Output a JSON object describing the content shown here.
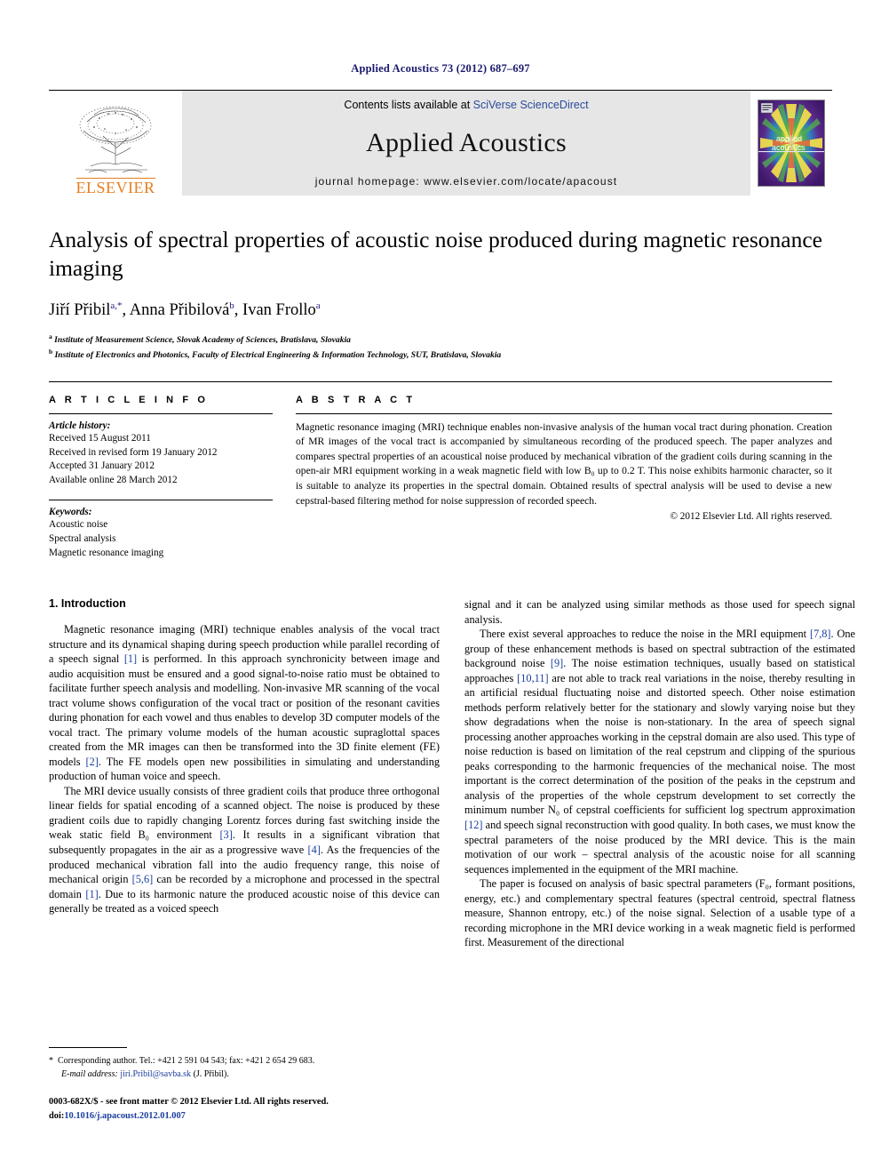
{
  "running_head": "Applied Acoustics 73 (2012) 687–697",
  "banner": {
    "publisher": "ELSEVIER",
    "contents_prefix": "Contents lists available at ",
    "contents_link": "SciVerse ScienceDirect",
    "journal_name": "Applied Acoustics",
    "homepage": "journal homepage: www.elsevier.com/locate/apacoust",
    "cover_line1": "applied",
    "cover_line2": "acoustics",
    "colors": {
      "link_blue": "#2a4b9b",
      "elsevier_orange": "#e87d1e",
      "banner_grey": "#e6e6e6",
      "citation_blue": "#1a3f9e",
      "runhead_navy": "#1a1a6e"
    }
  },
  "article": {
    "title": "Analysis of spectral properties of acoustic noise produced during magnetic resonance imaging",
    "authors": [
      {
        "name": "Jiří Přibil",
        "sup": "a,*"
      },
      {
        "name": "Anna Přibilová",
        "sup": "b"
      },
      {
        "name": "Ivan Frollo",
        "sup": "a"
      }
    ],
    "affiliations": [
      {
        "mark": "a",
        "text": "Institute of Measurement Science, Slovak Academy of Sciences, Bratislava, Slovakia"
      },
      {
        "mark": "b",
        "text": "Institute of Electronics and Photonics, Faculty of Electrical Engineering & Information Technology, SUT, Bratislava, Slovakia"
      }
    ]
  },
  "info": {
    "heading": "A R T I C L E   I N F O",
    "history_label": "Article history:",
    "history": [
      "Received 15 August 2011",
      "Received in revised form 19 January 2012",
      "Accepted 31 January 2012",
      "Available online 28 March 2012"
    ],
    "keywords_label": "Keywords:",
    "keywords": [
      "Acoustic noise",
      "Spectral analysis",
      "Magnetic resonance imaging"
    ]
  },
  "abstract": {
    "heading": "A B S T R A C T",
    "text": "Magnetic resonance imaging (MRI) technique enables non-invasive analysis of the human vocal tract during phonation. Creation of MR images of the vocal tract is accompanied by simultaneous recording of the produced speech. The paper analyzes and compares spectral properties of an acoustical noise produced by mechanical vibration of the gradient coils during scanning in the open-air MRI equipment working in a weak magnetic field with low B₀ up to 0.2 T. This noise exhibits harmonic character, so it is suitable to analyze its properties in the spectral domain. Obtained results of spectral analysis will be used to devise a new cepstral-based filtering method for noise suppression of recorded speech.",
    "copyright": "© 2012 Elsevier Ltd. All rights reserved."
  },
  "body": {
    "section_heading": "1. Introduction",
    "left_paragraphs": [
      "Magnetic resonance imaging (MRI) technique enables analysis of the vocal tract structure and its dynamical shaping during speech production while parallel recording of a speech signal [1] is performed. In this approach synchronicity between image and audio acquisition must be ensured and a good signal-to-noise ratio must be obtained to facilitate further speech analysis and modelling. Non-invasive MR scanning of the vocal tract volume shows configuration of the vocal tract or position of the resonant cavities during phonation for each vowel and thus enables to develop 3D computer models of the vocal tract. The primary volume models of the human acoustic supraglottal spaces created from the MR images can then be transformed into the 3D finite element (FE) models [2]. The FE models open new possibilities in simulating and understanding production of human voice and speech.",
      "The MRI device usually consists of three gradient coils that produce three orthogonal linear fields for spatial encoding of a scanned object. The noise is produced by these gradient coils due to rapidly changing Lorentz forces during fast switching inside the weak static field B₀ environment [3]. It results in a significant vibration that subsequently propagates in the air as a progressive wave [4]. As the frequencies of the produced mechanical vibration fall into the audio frequency range, this noise of mechanical origin [5,6] can be recorded by a microphone and processed in the spectral domain [1]. Due to its harmonic nature the produced acoustic noise of this device can generally be treated as a voiced speech"
    ],
    "right_paragraphs": [
      "signal and it can be analyzed using similar methods as those used for speech signal analysis.",
      "There exist several approaches to reduce the noise in the MRI equipment [7,8]. One group of these enhancement methods is based on spectral subtraction of the estimated background noise [9]. The noise estimation techniques, usually based on statistical approaches [10,11] are not able to track real variations in the noise, thereby resulting in an artificial residual fluctuating noise and distorted speech. Other noise estimation methods perform relatively better for the stationary and slowly varying noise but they show degradations when the noise is non-stationary. In the area of speech signal processing another approaches working in the cepstral domain are also used. This type of noise reduction is based on limitation of the real cepstrum and clipping of the spurious peaks corresponding to the harmonic frequencies of the mechanical noise. The most important is the correct determination of the position of the peaks in the cepstrum and analysis of the properties of the whole cepstrum development to set correctly the minimum number N₀ of cepstral coefficients for sufficient log spectrum approximation [12] and speech signal reconstruction with good quality. In both cases, we must know the spectral parameters of the noise produced by the MRI device. This is the main motivation of our work – spectral analysis of the acoustic noise for all scanning sequences implemented in the equipment of the MRI machine.",
      "The paper is focused on analysis of basic spectral parameters (F₀, formant positions, energy, etc.) and complementary spectral features (spectral centroid, spectral flatness measure, Shannon entropy, etc.) of the noise signal. Selection of a usable type of a recording microphone in the MRI device working in a weak magnetic field is performed first. Measurement of the directional"
    ]
  },
  "footnote": {
    "star": "*",
    "corresponding": "Corresponding author. Tel.: +421 2 591 04 543; fax: +421 2 654 29 683.",
    "email_label": "E-mail address:",
    "email": "jiri.Pribil@savba.sk",
    "email_owner": "(J. Přibil)."
  },
  "footer": {
    "issn_line": "0003-682X/$ - see front matter © 2012 Elsevier Ltd. All rights reserved.",
    "doi_label": "doi:",
    "doi_value": "10.1016/j.apacoust.2012.01.007"
  }
}
